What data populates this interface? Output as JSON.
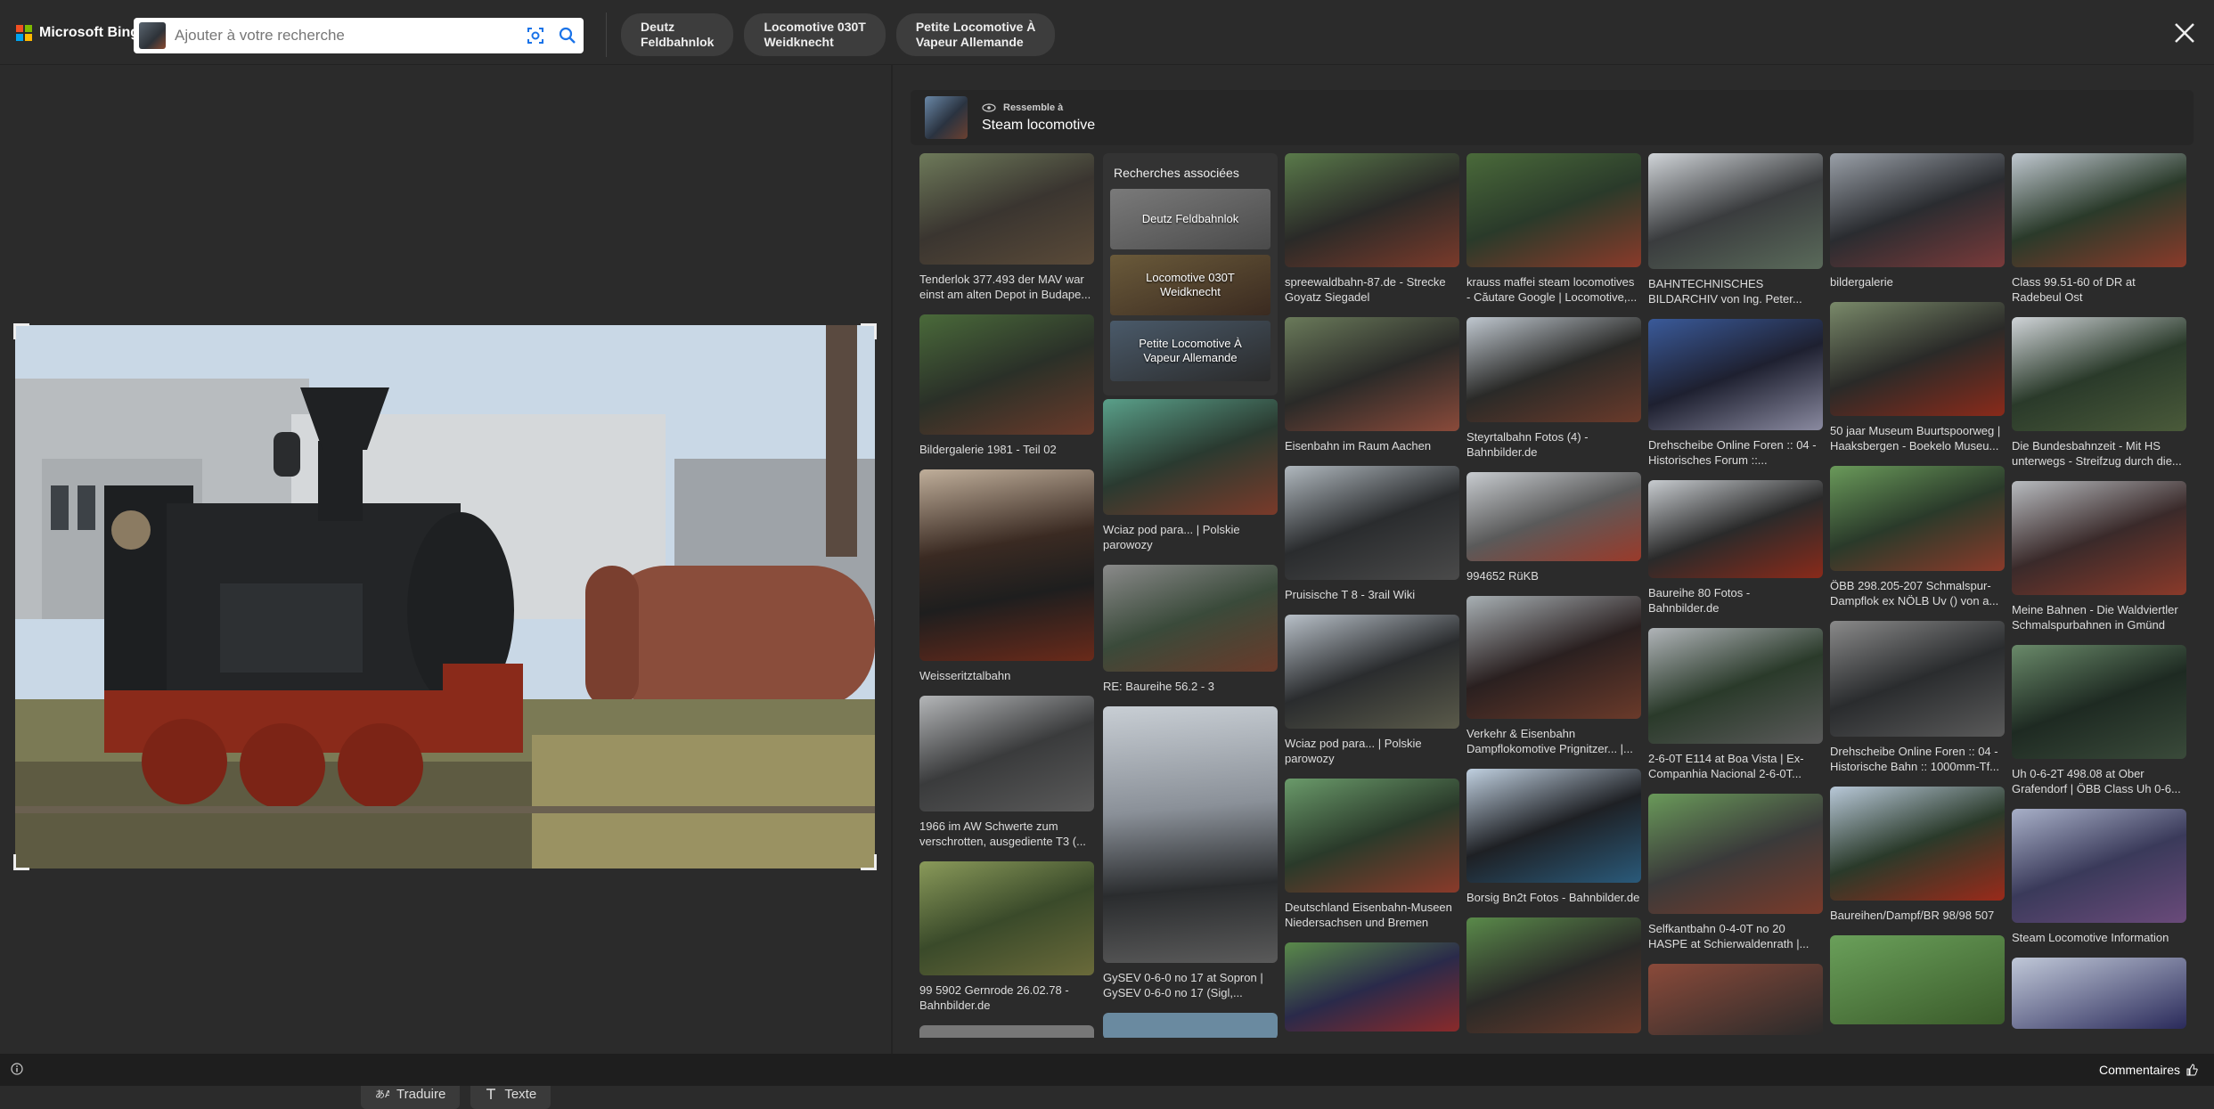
{
  "brand": {
    "logo_text": "Microsoft Bing"
  },
  "search": {
    "placeholder": "Ajouter à votre recherche"
  },
  "chips": [
    {
      "label": "Deutz\nFeldbahnlok"
    },
    {
      "label": "Locomotive 030T\nWeidknecht"
    },
    {
      "label": "Petite Locomotive À\nVapeur Allemande"
    }
  ],
  "tools": {
    "translate_label": "Traduire",
    "text_label": "Texte"
  },
  "visual_search": {
    "similar_label": "Ressemble à",
    "title": "Steam locomotive"
  },
  "related": {
    "title": "Recherches associées",
    "items": [
      "Deutz Feldbahnlok",
      "Locomotive 030T\nWeidknecht",
      "Petite Locomotive À\nVapeur Allemande"
    ]
  },
  "results": {
    "col1": [
      "Tenderlok 377.493 der MAV war einst am alten Depot in Budape...",
      "Bildergalerie 1981 - Teil 02",
      "Weisseritztalbahn",
      "1966 im AW Schwerte zum verschrotten, ausgediente T3 (...",
      "99 5902 Gernrode 26.02.78 - Bahnbilder.de"
    ],
    "col2": [
      "Wciaz pod para... | Polskie parowozy",
      "RE: Baureihe 56.2 - 3",
      "GySEV 0-6-0 no 17 at Sopron | GySEV 0-6-0 no 17 (Sigl,..."
    ],
    "col3": [
      "spreewaldbahn-87.de - Strecke Goyatz Siegadel",
      "Eisenbahn im Raum Aachen",
      "Pruisische T 8 - 3rail Wiki",
      "Wciaz pod para... | Polskie parowozy",
      "Deutschland Eisenbahn-Museen Niedersachsen und Bremen"
    ],
    "col4": [
      "krauss maffei steam locomotives - Căutare Google | Locomotive,...",
      "Steyrtalbahn Fotos (4) - Bahnbilder.de",
      "994652 RüKB",
      "Verkehr & Eisenbahn Dampflokomotive Prignitzer... |...",
      "Borsig Bn2t Fotos - Bahnbilder.de"
    ],
    "col5": [
      "BAHNTECHNISCHES BILDARCHIV von Ing. Peter...",
      "Drehscheibe Online Foren :: 04 - Historisches Forum ::...",
      "Baureihe 80 Fotos - Bahnbilder.de",
      "2-6-0T E114 at Boa Vista | Ex-Companhia Nacional 2-6-0T...",
      "Selfkantbahn 0-4-0T no 20 HASPE at Schierwaldenrath |..."
    ],
    "col6": [
      "bildergalerie",
      "50 jaar Museum Buurtspoorweg | Haaksbergen - Boekelo Museu...",
      "ÖBB 298.205-207 Schmalspur-Dampflok ex NÖLB Uv () von a...",
      "Drehscheibe Online Foren :: 04 - Historische Bahn :: 1000mm-Tf...",
      "Baureihen/Dampf/BR 98/98 507"
    ],
    "col7": [
      "Class 99.51-60 of DR at Radebeul Ost",
      "Die Bundesbahnzeit - Mit HS unterwegs - Streifzug durch die...",
      "Meine Bahnen - Die Waldviertler Schmalspurbahnen in Gmünd",
      "Uh 0-6-2T 498.08 at Ober Grafendorf | ÖBB Class Uh 0-6...",
      "Steam Locomotive Information"
    ]
  },
  "footer": {
    "feedback_label": "Commentaires"
  }
}
